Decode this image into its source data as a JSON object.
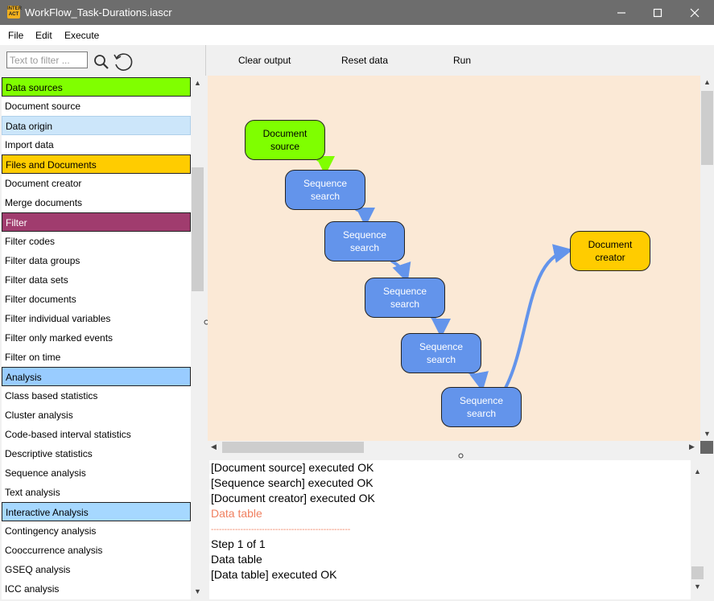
{
  "window": {
    "title": "WorkFlow_Task-Durations.iascr",
    "icon_text": "INTER ACT"
  },
  "menu": [
    {
      "label": "File"
    },
    {
      "label": "Edit"
    },
    {
      "label": "Execute"
    }
  ],
  "filter": {
    "placeholder": "Text to filter ..."
  },
  "toolbar": {
    "clear_label": "Clear output",
    "reset_label": "Reset data",
    "run_label": "Run"
  },
  "colors": {
    "data_sources": "#80ff00",
    "data_origin": "#cce6fa",
    "files_and_documents": "#ffcc00",
    "filter": "#a03c6e",
    "analysis": "#99ccff",
    "interactive_analysis": "#a6d8ff",
    "sequence_node": "#6394eb",
    "canvas_background": "#fbe9d6",
    "output_error": "#f08060"
  },
  "sidebar": {
    "items": [
      {
        "label": "Data sources",
        "category": true,
        "color": "#80ff00",
        "text_color": "#000"
      },
      {
        "label": "Document source"
      },
      {
        "label": "Data origin",
        "category": true,
        "color": "#cce6fa",
        "text_color": "#000",
        "border": "#b0d0ea"
      },
      {
        "label": "Import data"
      },
      {
        "label": "Files and Documents",
        "category": true,
        "color": "#ffcc00",
        "text_color": "#000"
      },
      {
        "label": "Document creator"
      },
      {
        "label": "Merge documents"
      },
      {
        "label": "Filter",
        "category": true,
        "color": "#a03c6e",
        "text_color": "#fff"
      },
      {
        "label": "Filter codes"
      },
      {
        "label": "Filter data groups"
      },
      {
        "label": "Filter data sets"
      },
      {
        "label": "Filter documents"
      },
      {
        "label": "Filter individual variables"
      },
      {
        "label": "Filter only marked events"
      },
      {
        "label": "Filter on time"
      },
      {
        "label": "Analysis",
        "category": true,
        "color": "#99ccff",
        "text_color": "#000"
      },
      {
        "label": "Class based statistics"
      },
      {
        "label": "Cluster analysis"
      },
      {
        "label": "Code-based interval statistics"
      },
      {
        "label": "Descriptive statistics"
      },
      {
        "label": "Sequence analysis"
      },
      {
        "label": "Text analysis"
      },
      {
        "label": "Interactive Analysis",
        "category": true,
        "color": "#a6d8ff",
        "text_color": "#000"
      },
      {
        "label": "Contingency analysis"
      },
      {
        "label": "Cooccurrence analysis"
      },
      {
        "label": "GSEQ analysis"
      },
      {
        "label": "ICC analysis"
      }
    ]
  },
  "workflow": {
    "nodes": [
      {
        "id": "n1",
        "line1": "Document",
        "line2": "source",
        "kind": "src"
      },
      {
        "id": "n2",
        "line1": "Sequence",
        "line2": "search",
        "kind": "seq"
      },
      {
        "id": "n3",
        "line1": "Sequence",
        "line2": "search",
        "kind": "seq"
      },
      {
        "id": "n4",
        "line1": "Sequence",
        "line2": "search",
        "kind": "seq"
      },
      {
        "id": "n5",
        "line1": "Sequence",
        "line2": "search",
        "kind": "seq"
      },
      {
        "id": "n6",
        "line1": "Sequence",
        "line2": "search",
        "kind": "seq"
      },
      {
        "id": "n7",
        "line1": "Document",
        "line2": "creator",
        "kind": "doc"
      }
    ]
  },
  "output": {
    "lines": [
      {
        "text": "[Document source] executed OK"
      },
      {
        "text": "[Sequence search] executed OK"
      },
      {
        "text": "[Document creator] executed OK"
      },
      {
        "text": "Data table",
        "color": "#f08060"
      },
      {
        "text": "----------------------------------------------------",
        "color": "#f08060",
        "small": true
      },
      {
        "text": "Step 1 of 1"
      },
      {
        "text": "Data table"
      },
      {
        "text": "[Data table] executed OK"
      }
    ]
  }
}
